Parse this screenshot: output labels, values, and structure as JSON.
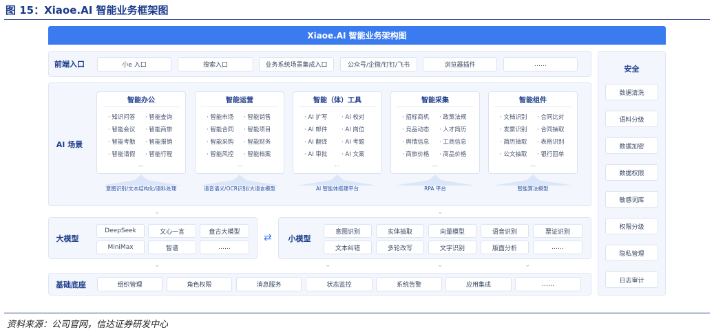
{
  "figure": {
    "title": "图 15：Xiaoe.AI 智能业务框架图",
    "source": "资料来源：公司官网，信达证券研发中心"
  },
  "diagram": {
    "banner": "Xiaoe.AI 智能业务架构图",
    "frontend": {
      "label": "前端入口",
      "items": [
        "小e 入口",
        "搜索入口",
        "业务系统场景集成入口",
        "公众号/企微/钉钉/飞书",
        "浏览器插件",
        "……"
      ]
    },
    "ai_scene": {
      "label": "AI 场景",
      "cards": [
        {
          "title": "智能办公",
          "items": [
            "知识问答",
            "智能查询",
            "智能会议",
            "智能商旅",
            "智能考勤",
            "智能报销",
            "智能请假",
            "智能行程"
          ],
          "more": "…",
          "platform": "意图识别/文本结构化/语料处理"
        },
        {
          "title": "智能运营",
          "items": [
            "智能市场",
            "智能销售",
            "智能合同",
            "智能项目",
            "智能采购",
            "智能财务",
            "智能风控",
            "智能档案"
          ],
          "more": "…",
          "platform": "语音语义/OCR识别/大语言模型"
        },
        {
          "title": "智能（体）工具",
          "items": [
            "AI 扩写",
            "AI 校对",
            "AI 邮件",
            "AI 岗位",
            "AI 翻译",
            "AI 考题",
            "AI 审批",
            "AI 文案"
          ],
          "more": "…",
          "platform": "AI 智能体搭建平台"
        },
        {
          "title": "智能采集",
          "items": [
            "招标商机",
            "政策法规",
            "竞品动态",
            "人才简历",
            "舆情信息",
            "工商信息",
            "商旅价格",
            "商品价格"
          ],
          "more": "…",
          "platform": "RPA 平台"
        },
        {
          "title": "智能组件",
          "items": [
            "文档识别",
            "合同比对",
            "发票识别",
            "合同抽取",
            "简历抽取",
            "表格识别",
            "公文抽取",
            "银行回单"
          ],
          "more": "…",
          "platform": "智能算法模型"
        }
      ]
    },
    "big_model": {
      "label": "大模型",
      "items": [
        "DeepSeek",
        "文心一言",
        "盘古大模型",
        "MiniMax",
        "智谱",
        "……"
      ]
    },
    "small_model": {
      "label": "小模型",
      "items": [
        "意图识别",
        "实体抽取",
        "向量模型",
        "语音识别",
        "票证识别",
        "文本纠错",
        "多轮改写",
        "文字识别",
        "版面分析",
        "……"
      ]
    },
    "exchange_symbol": "⇄",
    "foundation": {
      "label": "基础底座",
      "items": [
        "组织管理",
        "角色权限",
        "消息服务",
        "状态监控",
        "系统告警",
        "应用集成",
        "……"
      ]
    },
    "security": {
      "title": "安全",
      "items": [
        "数据清洗",
        "语料分级",
        "数据加密",
        "数据权限",
        "敏感词库",
        "权限分级",
        "隐私管理",
        "日志审计"
      ]
    }
  }
}
